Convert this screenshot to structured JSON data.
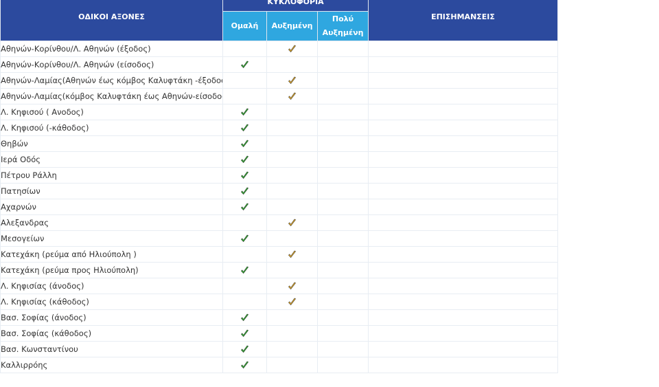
{
  "header": {
    "axes": "ΟΔΙΚΟΙ ΑΞΟΝΕΣ",
    "traffic": "ΚΥΚΛΟΦΟΡΙΑ",
    "notes": "ΕΠΙΣΗΜΑΝΣΕΙΣ",
    "levels": [
      "Ομαλή",
      "Αυξημένη",
      "Πολύ Αυξημένη"
    ]
  },
  "colors": {
    "header_dark": "#2c4a9e",
    "header_light": "#2fa7e0",
    "check_normal": "#2db82d",
    "check_increased": "#f0b020"
  },
  "rows": [
    {
      "road": "Αθηνών-Κορίνθου/Λ. Αθηνών (έξοδος)",
      "level": 1
    },
    {
      "road": "Αθηνών-Κορίνθου/Λ. Αθηνών (είσοδος)",
      "level": 0
    },
    {
      "road": "Αθηνών-Λαμίας(Αθηνών έως κόμβος Καλυφτάκη -έξοδος)",
      "level": 1
    },
    {
      "road": "Αθηνών-Λαμίας(κόμβος Καλυφτάκη έως Αθηνών-είσοδος)",
      "level": 1
    },
    {
      "road": "Λ. Κηφισού ( Ανοδος)",
      "level": 0
    },
    {
      "road": "Λ. Κηφισού (-κάθοδος)",
      "level": 0
    },
    {
      "road": "Θηβών",
      "level": 0
    },
    {
      "road": "Ιερά Οδός",
      "level": 0
    },
    {
      "road": "Πέτρου Ράλλη",
      "level": 0
    },
    {
      "road": "Πατησίων",
      "level": 0
    },
    {
      "road": "Αχαρνών",
      "level": 0
    },
    {
      "road": "Αλεξανδρας",
      "level": 1
    },
    {
      "road": "Μεσογείων",
      "level": 0
    },
    {
      "road": "Κατεχάκη (ρεύμα από Ηλιούπολη )",
      "level": 1
    },
    {
      "road": "Κατεχάκη (ρεύμα προς Ηλιούπολη)",
      "level": 0
    },
    {
      "road": "Λ. Κηφισίας (άνοδος)",
      "level": 1
    },
    {
      "road": "Λ. Κηφισίας (κάθοδος)",
      "level": 1
    },
    {
      "road": "Βασ. Σοφίας (άνοδος)",
      "level": 0
    },
    {
      "road": "Βασ. Σοφίας (κάθοδος)",
      "level": 0
    },
    {
      "road": "Βασ. Κωνσταντίνου",
      "level": 0
    },
    {
      "road": "Καλλιρρόης",
      "level": 0
    }
  ]
}
